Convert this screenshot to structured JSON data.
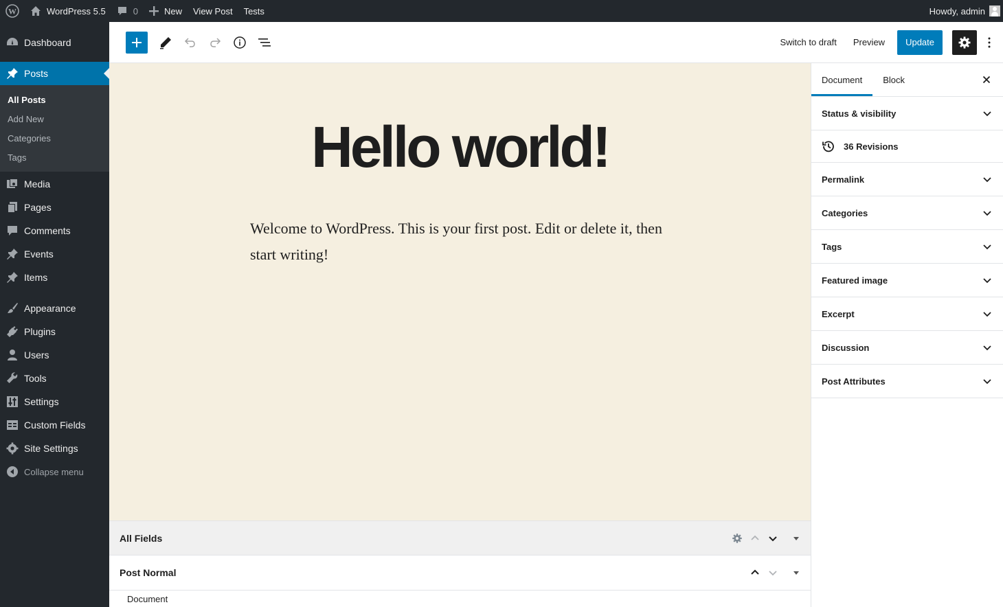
{
  "admin_bar": {
    "site_name": "WordPress 5.5",
    "comments_count": "0",
    "new_label": "New",
    "view_post_label": "View Post",
    "tests_label": "Tests",
    "howdy": "Howdy, admin"
  },
  "sidebar": {
    "dashboard": "Dashboard",
    "posts": "Posts",
    "posts_sub": [
      "All Posts",
      "Add New",
      "Categories",
      "Tags"
    ],
    "media": "Media",
    "pages": "Pages",
    "comments": "Comments",
    "events": "Events",
    "items": "Items",
    "appearance": "Appearance",
    "plugins": "Plugins",
    "users": "Users",
    "tools": "Tools",
    "settings": "Settings",
    "custom_fields": "Custom Fields",
    "site_settings": "Site Settings",
    "collapse": "Collapse menu"
  },
  "header": {
    "switch_to_draft": "Switch to draft",
    "preview": "Preview",
    "update": "Update"
  },
  "post": {
    "title": "Hello world!",
    "body": "Welcome to WordPress. This is your first post. Edit or delete it, then start writing!"
  },
  "metaboxes": {
    "all_fields": "All Fields",
    "post_normal": "Post Normal",
    "document": "Document"
  },
  "settings_panel": {
    "tabs": [
      "Document",
      "Block"
    ],
    "status_visibility": "Status & visibility",
    "revisions": "36 Revisions",
    "permalink": "Permalink",
    "categories": "Categories",
    "tags": "Tags",
    "featured_image": "Featured image",
    "excerpt": "Excerpt",
    "discussion": "Discussion",
    "post_attributes": "Post Attributes"
  },
  "colors": {
    "admin_dark": "#23282d",
    "accent": "#007cba",
    "canvas_bg": "#f5efe0"
  }
}
